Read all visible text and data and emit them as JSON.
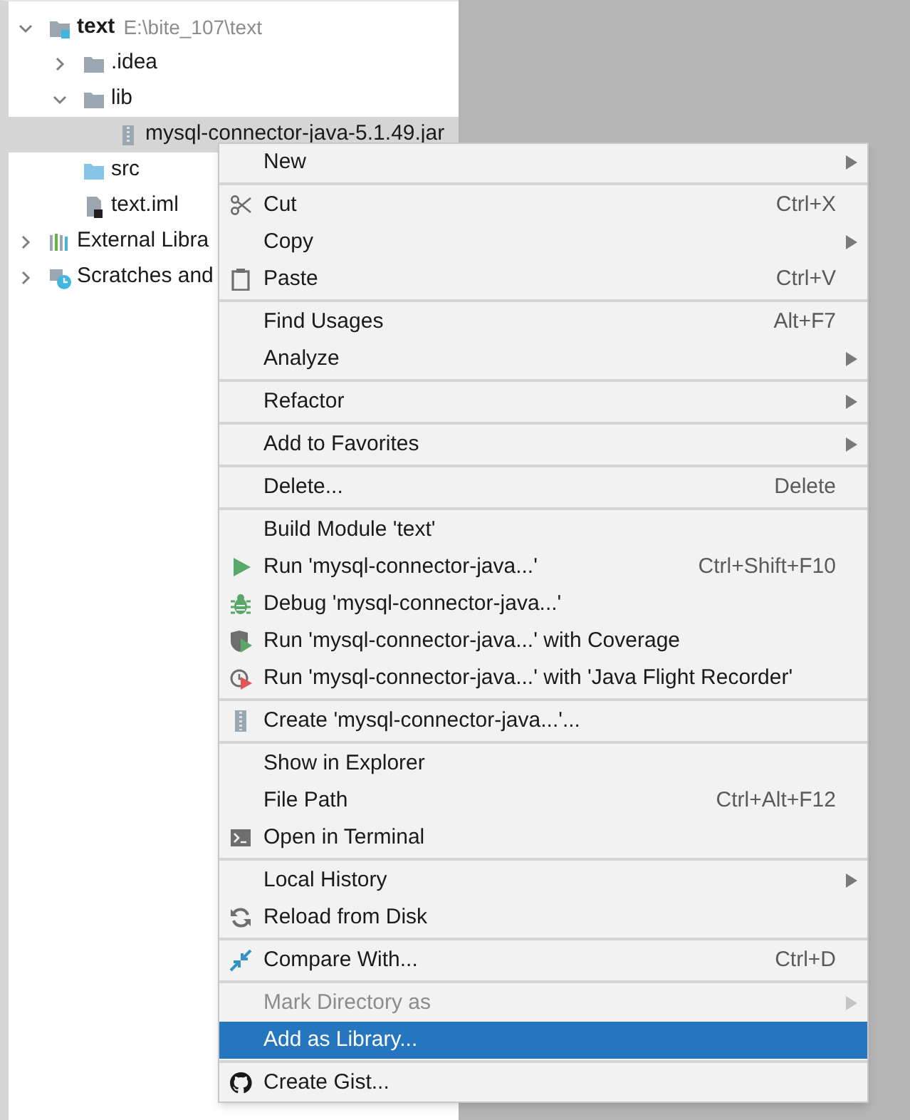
{
  "project_tree": {
    "items": [
      {
        "label": "text",
        "path": "E:\\bite_107\\text",
        "kind": "module",
        "expanded": true,
        "selected": false,
        "children": [
          {
            "label": ".idea",
            "kind": "folder",
            "expanded": false,
            "selected": false
          },
          {
            "label": "lib",
            "kind": "folder",
            "expanded": true,
            "selected": false,
            "children": [
              {
                "label": "mysql-connector-java-5.1.49.jar",
                "kind": "jar",
                "selected": true
              }
            ]
          },
          {
            "label": "src",
            "kind": "source",
            "selected": false
          },
          {
            "label": "text.iml",
            "kind": "iml",
            "selected": false
          }
        ]
      },
      {
        "label": "External Libra",
        "kind": "libraries",
        "expanded": false,
        "selected": false
      },
      {
        "label": "Scratches and",
        "kind": "scratches",
        "expanded": false,
        "selected": false
      }
    ]
  },
  "context_menu": {
    "groups": [
      [
        {
          "label": "New",
          "submenu": true,
          "disabled": false,
          "selected": false
        }
      ],
      [
        {
          "label": "Cut",
          "kind": "scissors",
          "shortcut": "Ctrl+X",
          "disabled": false,
          "selected": false
        },
        {
          "label": "Copy",
          "submenu": true,
          "disabled": false,
          "selected": false
        },
        {
          "label": "Paste",
          "kind": "clipboard",
          "shortcut": "Ctrl+V",
          "disabled": false,
          "selected": false
        }
      ],
      [
        {
          "label": "Find Usages",
          "shortcut": "Alt+F7",
          "disabled": false,
          "selected": false
        },
        {
          "label": "Analyze",
          "submenu": true,
          "disabled": false,
          "selected": false
        }
      ],
      [
        {
          "label": "Refactor",
          "submenu": true,
          "disabled": false,
          "selected": false
        }
      ],
      [
        {
          "label": "Add to Favorites",
          "submenu": true,
          "disabled": false,
          "selected": false
        }
      ],
      [
        {
          "label": "Delete...",
          "shortcut": "Delete",
          "disabled": false,
          "selected": false
        }
      ],
      [
        {
          "label": "Build Module 'text'",
          "disabled": false,
          "selected": false
        },
        {
          "label": "Run 'mysql-connector-java...'",
          "kind": "run",
          "shortcut": "Ctrl+Shift+F10",
          "disabled": false,
          "selected": false
        },
        {
          "label": "Debug 'mysql-connector-java...'",
          "kind": "bug",
          "disabled": false,
          "selected": false
        },
        {
          "label": "Run 'mysql-connector-java...' with Coverage",
          "kind": "coverage",
          "disabled": false,
          "selected": false
        },
        {
          "label": "Run 'mysql-connector-java...' with 'Java Flight Recorder'",
          "kind": "recorder",
          "disabled": false,
          "selected": false
        }
      ],
      [
        {
          "label": "Create 'mysql-connector-java...'...",
          "kind": "archive",
          "disabled": false,
          "selected": false
        }
      ],
      [
        {
          "label": "Show in Explorer",
          "disabled": false,
          "selected": false
        },
        {
          "label": "File Path",
          "shortcut": "Ctrl+Alt+F12",
          "disabled": false,
          "selected": false
        },
        {
          "label": "Open in Terminal",
          "kind": "terminal",
          "disabled": false,
          "selected": false
        }
      ],
      [
        {
          "label": "Local History",
          "submenu": true,
          "disabled": false,
          "selected": false
        },
        {
          "label": "Reload from Disk",
          "kind": "reload",
          "disabled": false,
          "selected": false
        }
      ],
      [
        {
          "label": "Compare With...",
          "kind": "compare",
          "shortcut": "Ctrl+D",
          "disabled": false,
          "selected": false
        }
      ],
      [
        {
          "label": "Mark Directory as",
          "submenu": true,
          "disabled": true,
          "selected": false
        },
        {
          "label": "Add as Library...",
          "disabled": false,
          "selected": true
        }
      ],
      [
        {
          "label": "Create Gist...",
          "kind": "github",
          "disabled": false,
          "selected": false
        }
      ]
    ]
  }
}
